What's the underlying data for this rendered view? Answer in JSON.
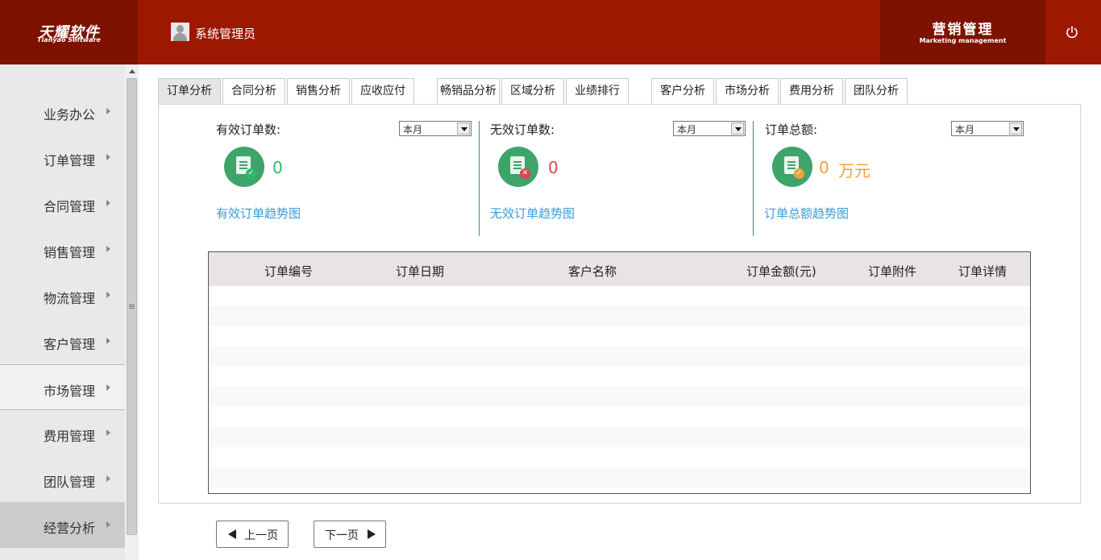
{
  "header": {
    "logo_cn": "天耀软件",
    "logo_en": "Tianyao Software",
    "user_name": "系统管理员",
    "module_cn": "营销管理",
    "module_en": "Marketing management",
    "brand_color": "#9c1800"
  },
  "sidebar": {
    "items": [
      {
        "label": "业务办公"
      },
      {
        "label": "订单管理"
      },
      {
        "label": "合同管理"
      },
      {
        "label": "销售管理"
      },
      {
        "label": "物流管理"
      },
      {
        "label": "客户管理"
      },
      {
        "label": "市场管理"
      },
      {
        "label": "费用管理"
      },
      {
        "label": "团队管理"
      },
      {
        "label": "经营分析"
      }
    ]
  },
  "tabs": [
    {
      "label": "订单分析"
    },
    {
      "label": "合同分析"
    },
    {
      "label": "销售分析"
    },
    {
      "label": "应收应付"
    },
    {
      "label": "畅销品分析"
    },
    {
      "label": "区域分析"
    },
    {
      "label": "业绩排行"
    },
    {
      "label": "客户分析"
    },
    {
      "label": "市场分析"
    },
    {
      "label": "费用分析"
    },
    {
      "label": "团队分析"
    }
  ],
  "stats": [
    {
      "label": "有效订单数:",
      "period": "本月",
      "value": "0",
      "unit": "",
      "trend_link": "有效订单趋势图",
      "color": "#2dbb6a"
    },
    {
      "label": "无效订单数:",
      "period": "本月",
      "value": "0",
      "unit": "",
      "trend_link": "无效订单趋势图",
      "color": "#e0434a"
    },
    {
      "label": "订单总额:",
      "period": "本月",
      "value": "0",
      "unit": "万元",
      "trend_link": "订单总额趋势图",
      "color": "#f0a23a"
    }
  ],
  "table": {
    "columns": [
      "订单编号",
      "订单日期",
      "客户名称",
      "订单金额(元)",
      "订单附件",
      "订单详情"
    ],
    "rows": []
  },
  "pagination": {
    "prev": "上一页",
    "next": "下一页"
  }
}
